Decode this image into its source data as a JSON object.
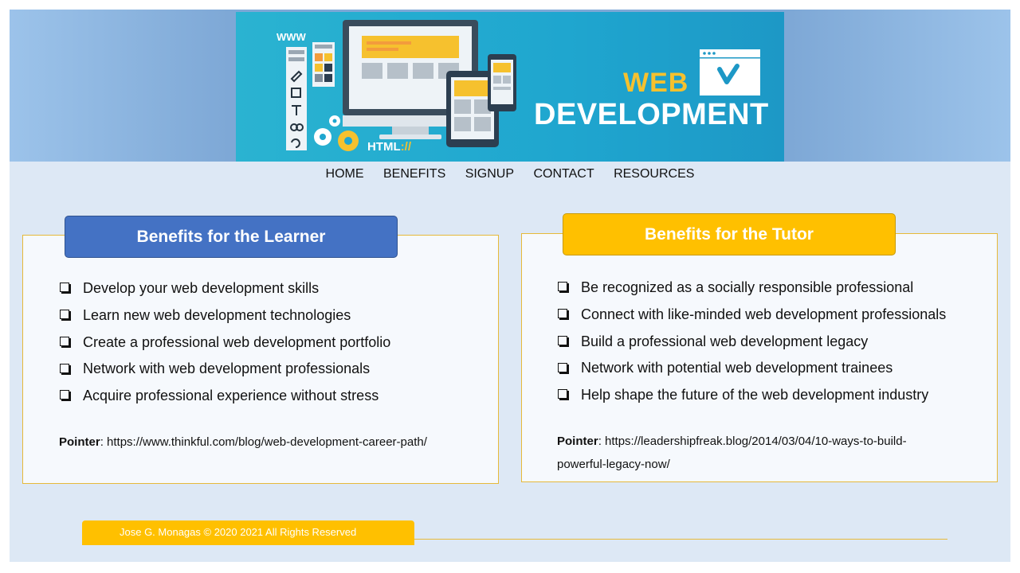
{
  "banner": {
    "title_top": "WEB",
    "title_bottom": "DEVELOPMENT",
    "www_label": "WWW",
    "html_label": "HTML",
    "html_suffix": "://"
  },
  "nav": {
    "items": [
      "HOME",
      "BENEFITS",
      "SIGNUP",
      "CONTACT",
      "RESOURCES"
    ]
  },
  "learner": {
    "title": "Benefits for the Learner",
    "items": [
      "Develop your web development skills",
      "Learn new web development technologies",
      "Create a professional web development portfolio",
      "Network with  web development professionals",
      "Acquire professional experience without stress"
    ],
    "pointer_label": "Pointer",
    "pointer_url": "https://www.thinkful.com/blog/web-development-career-path/"
  },
  "tutor": {
    "title": "Benefits for the Tutor",
    "items": [
      "Be recognized as a socially responsible professional",
      "Connect with  like-minded web development professionals",
      "Build  a professional web development legacy",
      "Network with  potential web development trainees",
      "Help shape the future of the web development industry"
    ],
    "pointer_label": "Pointer",
    "pointer_url_line1": "https://leadershipfreak.blog/2014/03/04/10-ways-to-build-",
    "pointer_url_line2": "powerful-legacy-now/"
  },
  "footer": {
    "copyright": "Jose G. Monagas © 2020 2021 All Rights Reserved"
  },
  "colors": {
    "learner_accent": "#4472c4",
    "tutor_accent": "#ffc000",
    "banner_bg": "#1fa6cf",
    "page_bg": "#dde8f5"
  }
}
